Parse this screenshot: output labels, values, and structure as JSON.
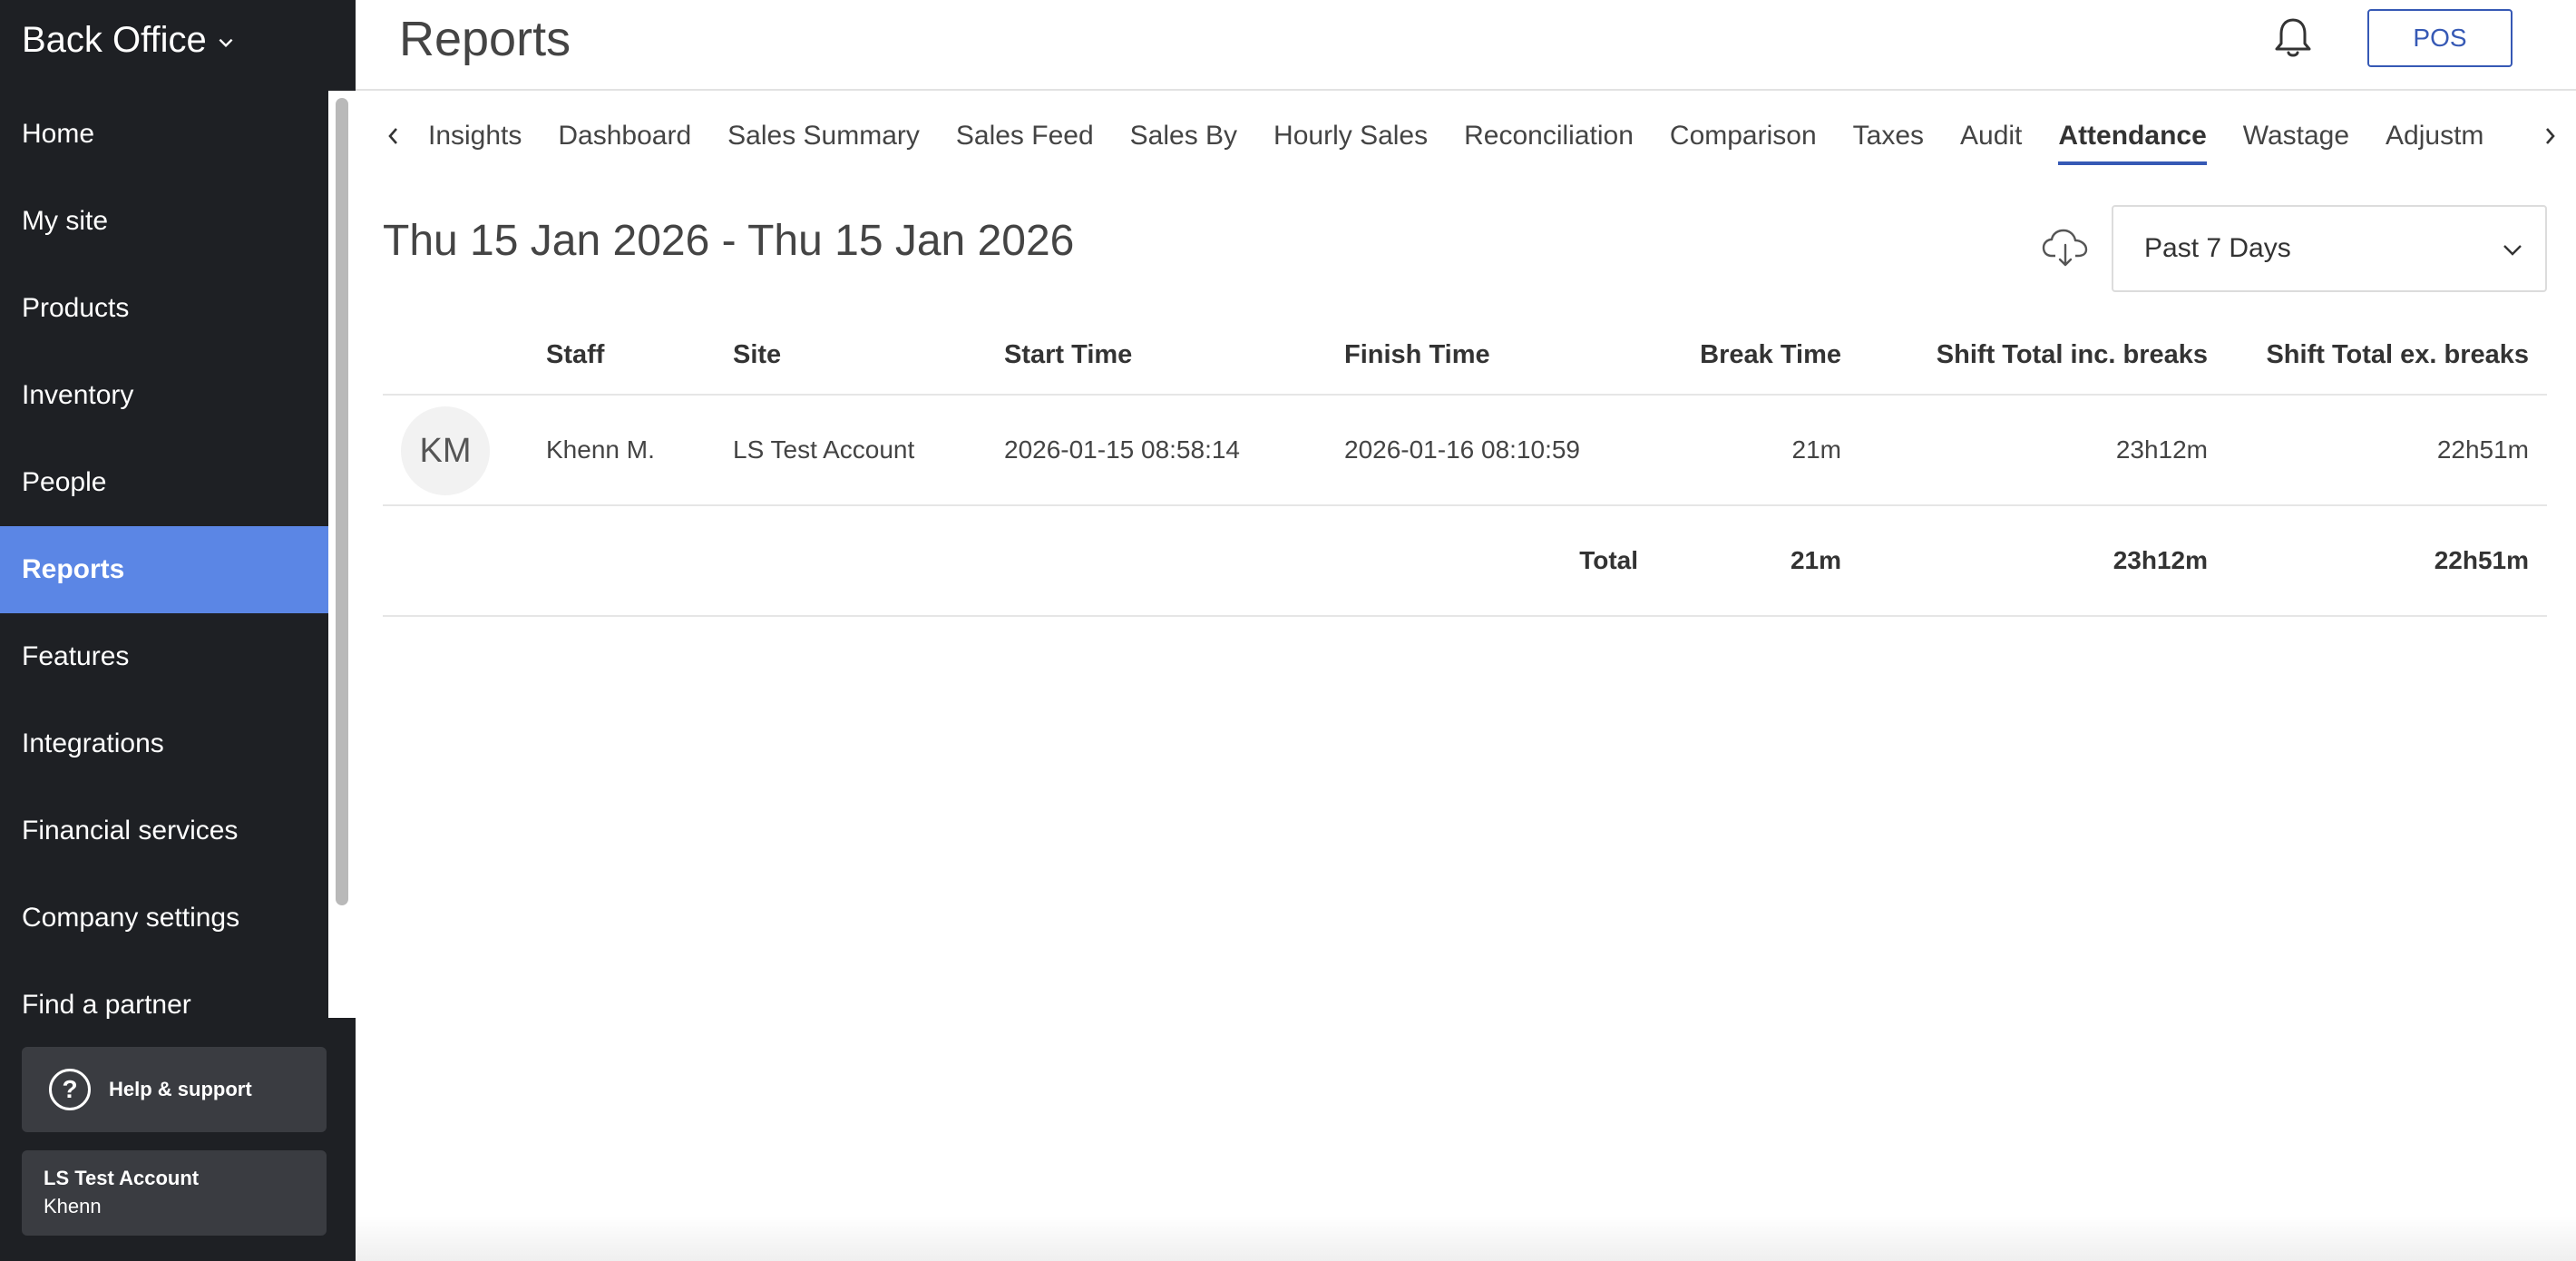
{
  "app": {
    "title": "Back Office"
  },
  "sidebar": {
    "items": [
      {
        "label": "Home"
      },
      {
        "label": "My site"
      },
      {
        "label": "Products"
      },
      {
        "label": "Inventory"
      },
      {
        "label": "People"
      },
      {
        "label": "Reports",
        "active": true
      },
      {
        "label": "Features"
      },
      {
        "label": "Integrations"
      },
      {
        "label": "Financial services"
      },
      {
        "label": "Company settings"
      },
      {
        "label": "Find a partner"
      }
    ],
    "help_label": "Help & support",
    "account": {
      "name": "LS Test Account",
      "user": "Khenn"
    }
  },
  "header": {
    "title": "Reports",
    "pos_label": "POS",
    "icons": {
      "notifications": "bell-icon"
    }
  },
  "tabs": [
    {
      "label": "Insights"
    },
    {
      "label": "Dashboard"
    },
    {
      "label": "Sales Summary"
    },
    {
      "label": "Sales Feed"
    },
    {
      "label": "Sales By"
    },
    {
      "label": "Hourly Sales"
    },
    {
      "label": "Reconciliation"
    },
    {
      "label": "Comparison"
    },
    {
      "label": "Taxes"
    },
    {
      "label": "Audit"
    },
    {
      "label": "Attendance",
      "active": true
    },
    {
      "label": "Wastage"
    },
    {
      "label": "Adjustm"
    }
  ],
  "report": {
    "date_range": "Thu 15 Jan 2026 - Thu 15 Jan 2026",
    "period": "Past 7 Days",
    "icons": {
      "export": "cloud-download-icon"
    },
    "columns": {
      "staff": "Staff",
      "site": "Site",
      "start": "Start Time",
      "finish": "Finish Time",
      "break": "Break Time",
      "inc": "Shift Total inc. breaks",
      "ex": "Shift Total ex. breaks"
    },
    "rows": [
      {
        "initials": "KM",
        "staff": "Khenn M.",
        "site": "LS Test Account",
        "start": "2026-01-15 08:58:14",
        "finish": "2026-01-16 08:10:59",
        "break": "21m",
        "inc": "23h12m",
        "ex": "22h51m"
      }
    ],
    "total": {
      "label": "Total",
      "break": "21m",
      "inc": "23h12m",
      "ex": "22h51m"
    }
  },
  "colors": {
    "sidebar_bg": "#1e2024",
    "active_nav": "#5b86e5",
    "accent": "#3659b5"
  }
}
